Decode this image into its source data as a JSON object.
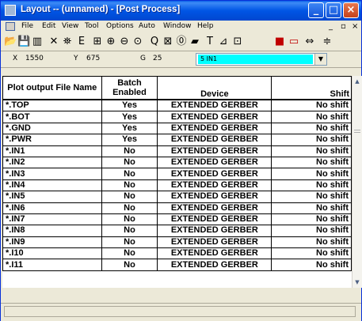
{
  "window": {
    "title": "Layout -- (unnamed) - [Post Process]",
    "controls": {
      "minimize": "_",
      "maximize": "□",
      "close": "×"
    }
  },
  "menu": {
    "items": [
      "File",
      "Edit",
      "View",
      "Tool",
      "Options",
      "Auto",
      "Window",
      "Help"
    ],
    "mdi_controls": [
      "_",
      "▫",
      "×"
    ]
  },
  "toolbar": {
    "icons": [
      "open-folder-icon",
      "save-icon",
      "bar-chart-icon",
      "delete-x-icon",
      "find-binoculars-icon",
      "select-e-icon",
      "grid-icon",
      "zoom-in-icon",
      "zoom-out-icon",
      "zoom-all-icon",
      "zoom-icon",
      "query-icon",
      "property-icon",
      "route-icon",
      "text-t-icon",
      "dimension-icon",
      "drc-icon",
      "color-icon",
      "design-rules-icon",
      "component-icon",
      "more-icon"
    ],
    "glyphs": [
      "📂",
      "💾",
      "▥",
      "✕",
      "⛯",
      "Ε",
      "⊞",
      "⊕",
      "⊖",
      "⊙",
      "Q",
      "⊠",
      "⓪",
      "▰",
      "T",
      "⊿",
      "⊡",
      "■",
      "▭",
      "⇔",
      "≑"
    ]
  },
  "coords": {
    "x_label": "X",
    "x_value": "1550",
    "y_label": "Y",
    "y_value": "675",
    "g_label": "G",
    "g_value": "25",
    "layer_value": "5 IN1"
  },
  "table": {
    "headers": [
      "Plot output File Name",
      "Batch Enabled",
      "Device",
      "Shift"
    ],
    "rows": [
      [
        "*.TOP",
        "Yes",
        "EXTENDED GERBER",
        "No shift"
      ],
      [
        "*.BOT",
        "Yes",
        "EXTENDED GERBER",
        "No shift"
      ],
      [
        "*.GND",
        "Yes",
        "EXTENDED GERBER",
        "No shift"
      ],
      [
        "*.PWR",
        "Yes",
        "EXTENDED GERBER",
        "No shift"
      ],
      [
        "*.IN1",
        "No",
        "EXTENDED GERBER",
        "No shift"
      ],
      [
        "*.IN2",
        "No",
        "EXTENDED GERBER",
        "No shift"
      ],
      [
        "*.IN3",
        "No",
        "EXTENDED GERBER",
        "No shift"
      ],
      [
        "*.IN4",
        "No",
        "EXTENDED GERBER",
        "No shift"
      ],
      [
        "*.IN5",
        "No",
        "EXTENDED GERBER",
        "No shift"
      ],
      [
        "*.IN6",
        "No",
        "EXTENDED GERBER",
        "No shift"
      ],
      [
        "*.IN7",
        "No",
        "EXTENDED GERBER",
        "No shift"
      ],
      [
        "*.IN8",
        "No",
        "EXTENDED GERBER",
        "No shift"
      ],
      [
        "*.IN9",
        "No",
        "EXTENDED GERBER",
        "No shift"
      ],
      [
        "*.I10",
        "No",
        "EXTENDED GERBER",
        "No shift"
      ],
      [
        "*.I11",
        "No",
        "EXTENDED GERBER",
        "No shift"
      ]
    ]
  },
  "colors": {
    "titlebar": "#0055E5",
    "layer_highlight": "#00FFFF",
    "window_bg": "#ECE9D8"
  }
}
